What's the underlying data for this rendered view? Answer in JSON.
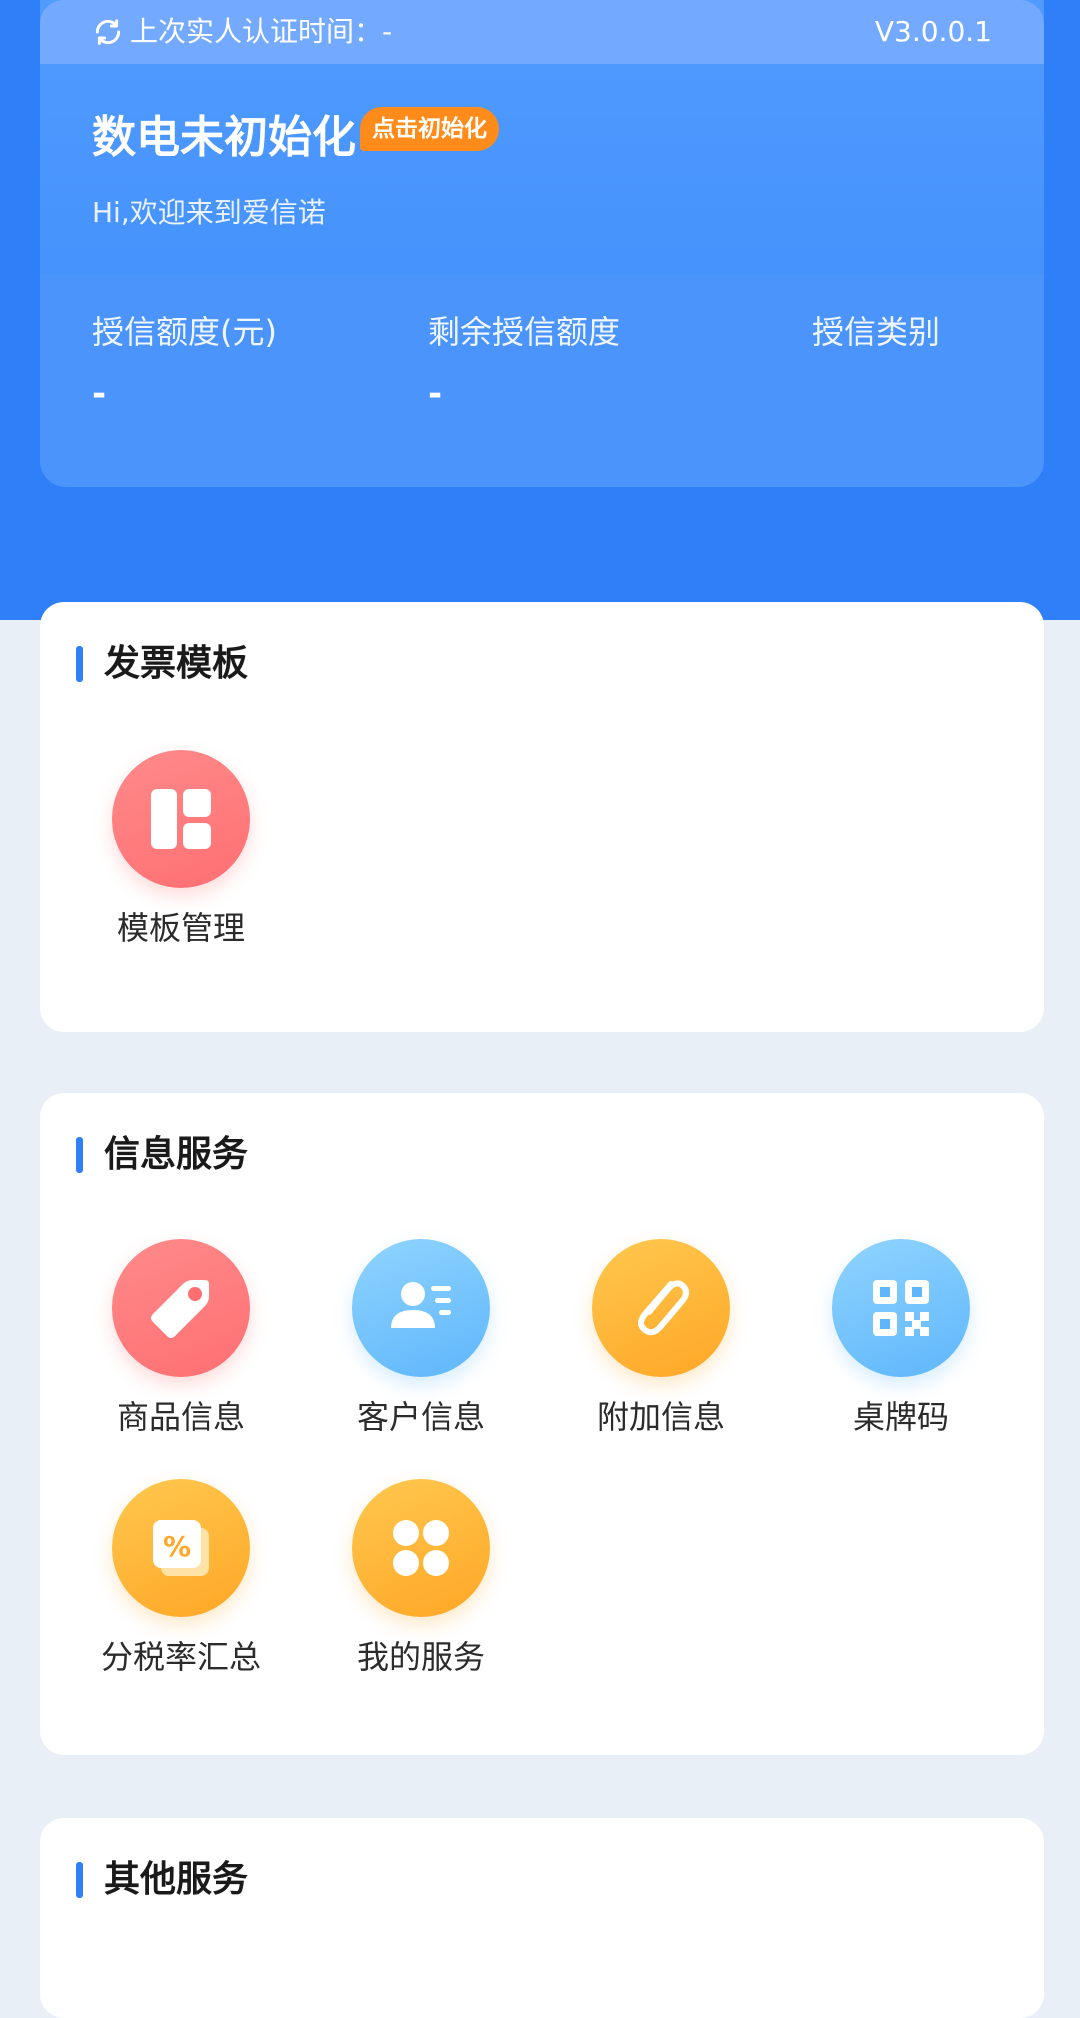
{
  "header": {
    "auth_label": "上次实人认证时间：-",
    "version": "V3.0.0.1",
    "status_title": "数电未初始化",
    "init_badge": "点击初始化",
    "welcome": "Hi,欢迎来到爱信诺"
  },
  "credit": {
    "limit_label": "授信额度(元)",
    "limit_value": "-",
    "remaining_label": "剩余授信额度",
    "remaining_value": "-",
    "category_label": "授信类别"
  },
  "sections": {
    "invoice_template": {
      "title": "发票模板",
      "items": [
        {
          "label": "模板管理",
          "icon": "template-layout-icon"
        }
      ]
    },
    "info_service": {
      "title": "信息服务",
      "items": [
        {
          "label": "商品信息",
          "icon": "tag-icon"
        },
        {
          "label": "客户信息",
          "icon": "contact-card-icon"
        },
        {
          "label": "附加信息",
          "icon": "paperclip-icon"
        },
        {
          "label": "桌牌码",
          "icon": "qr-code-icon"
        },
        {
          "label": "分税率汇总",
          "icon": "percent-doc-icon"
        },
        {
          "label": "我的服务",
          "icon": "grid-clover-icon"
        }
      ]
    },
    "other_service": {
      "title": "其他服务"
    }
  },
  "colors": {
    "primary": "#2f7ff9",
    "badge": "#ff8c1a",
    "page_bg": "#e9eff7"
  }
}
